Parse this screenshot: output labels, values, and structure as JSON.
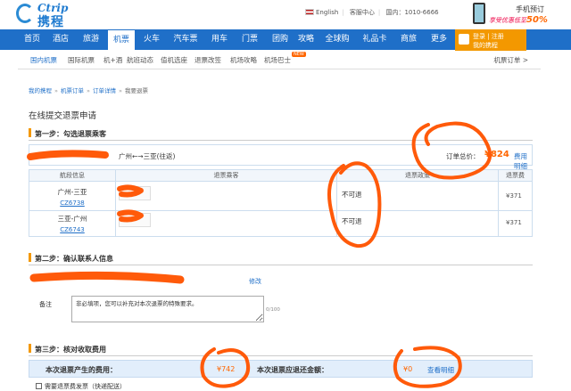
{
  "header": {
    "brand_en": "Ctrip",
    "brand_cn": "携程",
    "language": "English",
    "service_center": "客服中心",
    "phone": "国内：1010-6666",
    "mobile_title": "手机预订",
    "mobile_promo": "享受优惠低至",
    "mobile_discount": "50%"
  },
  "nav": {
    "items": [
      "首页",
      "酒店",
      "旅游",
      "机票",
      "火车",
      "汽车票",
      "用车",
      "门票",
      "团购",
      "攻略",
      "全球购",
      "礼品卡",
      "商旅",
      "更多"
    ],
    "login": "登录 | 注册",
    "my_ctrip": "我的携程"
  },
  "subnav": {
    "items": [
      "国内机票",
      "国际机票",
      "机+酒",
      "航班动态",
      "值机选座",
      "退票改签",
      "机场攻略",
      "机场巴士"
    ],
    "new_badge": "NEW",
    "right": "机票订单 >"
  },
  "breadcrumb": [
    "我的携程",
    "机票订单",
    "订单详情",
    "我要退票"
  ],
  "page_title": "在线提交退票申请",
  "step1": {
    "title": "第一步：勾选退票乘客",
    "route": "广州←→三亚(往返)",
    "total_label": "订单总价：",
    "total_value": "¥824",
    "detail": "费用明细",
    "headers": [
      "航段信息",
      "退票乘客",
      "退票政策",
      "退票费"
    ],
    "rows": [
      {
        "route": "广州-三亚",
        "flight": "CZ6738",
        "policy": "不可退",
        "fee": "¥371"
      },
      {
        "route": "三亚-广州",
        "flight": "CZ6743",
        "policy": "不可退",
        "fee": "¥371"
      }
    ]
  },
  "step2": {
    "title": "第二步：确认联系人信息",
    "edit": "修改",
    "remark_label": "备注",
    "remark_text": "非必填项，您可以补充对本次退票的特殊要求。",
    "remark_count": "0/100"
  },
  "step3": {
    "title": "第三步：核对收取费用",
    "fee_label": "本次退票产生的费用：",
    "fee_value": "¥742",
    "refund_label": "本次退票应退还金额：",
    "refund_value": "¥0",
    "view_detail": "查看明细",
    "invoice": "需要退票费发票（快递配送）"
  },
  "colors": {
    "nav_blue": "#1f6fc8",
    "accent_orange": "#f39800",
    "scribble": "#ff5a0a"
  }
}
